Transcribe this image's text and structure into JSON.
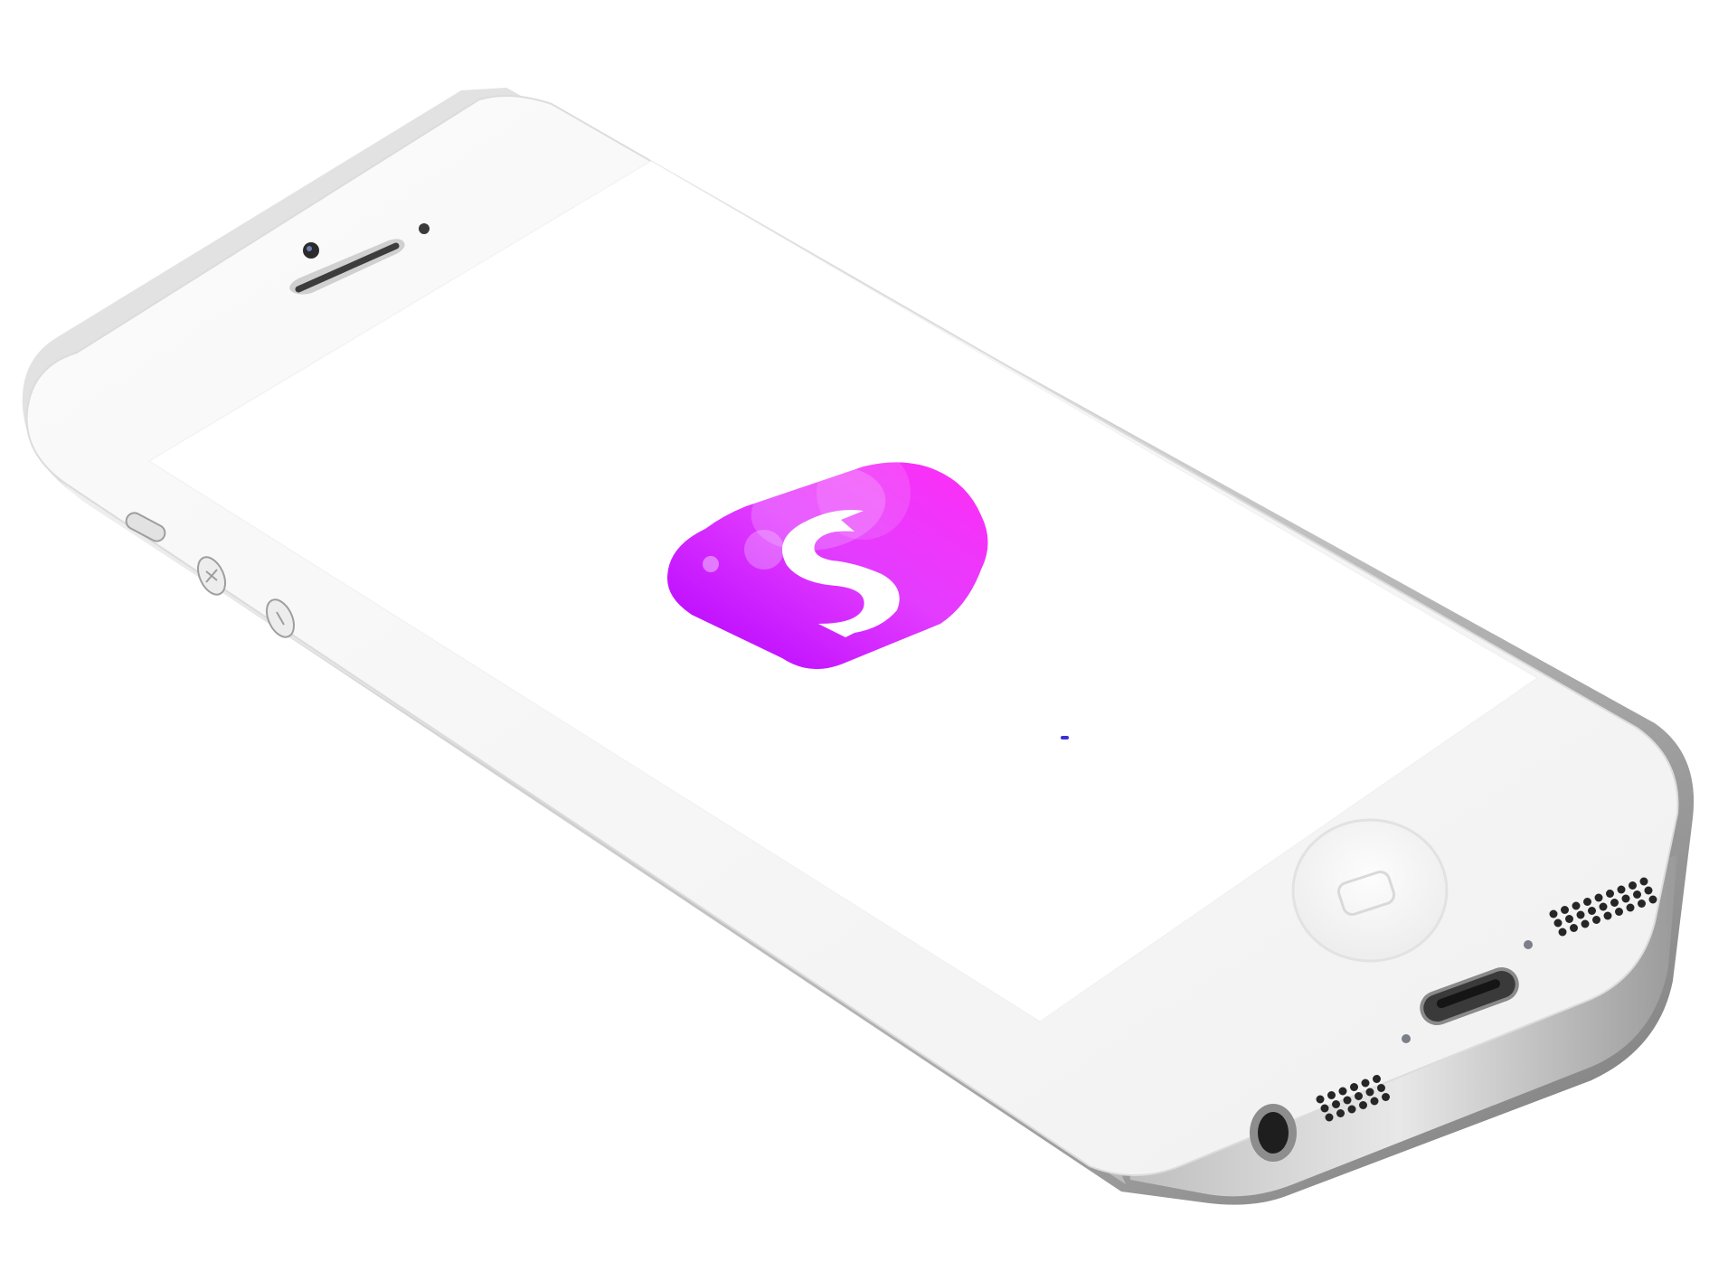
{
  "device": {
    "model": "iphone-white",
    "orientation": "landscape-tilted"
  },
  "screen": {
    "background": "#ffffff",
    "state": "launch-screen"
  },
  "app": {
    "icon_name": "s-letter-app-icon",
    "icon_letter": "S",
    "gradient_colors": [
      "#b300ff",
      "#e33cff",
      "#ff2df6"
    ],
    "loading_indicator_color": "#3b2fd6"
  },
  "hardware": {
    "icons": [
      "earpiece-icon",
      "front-camera-icon",
      "proximity-sensor-icon",
      "home-button-icon",
      "volume-up-icon",
      "volume-down-icon",
      "mute-switch-icon",
      "lightning-port-icon",
      "headphone-jack-icon",
      "speaker-grille-icon"
    ]
  }
}
